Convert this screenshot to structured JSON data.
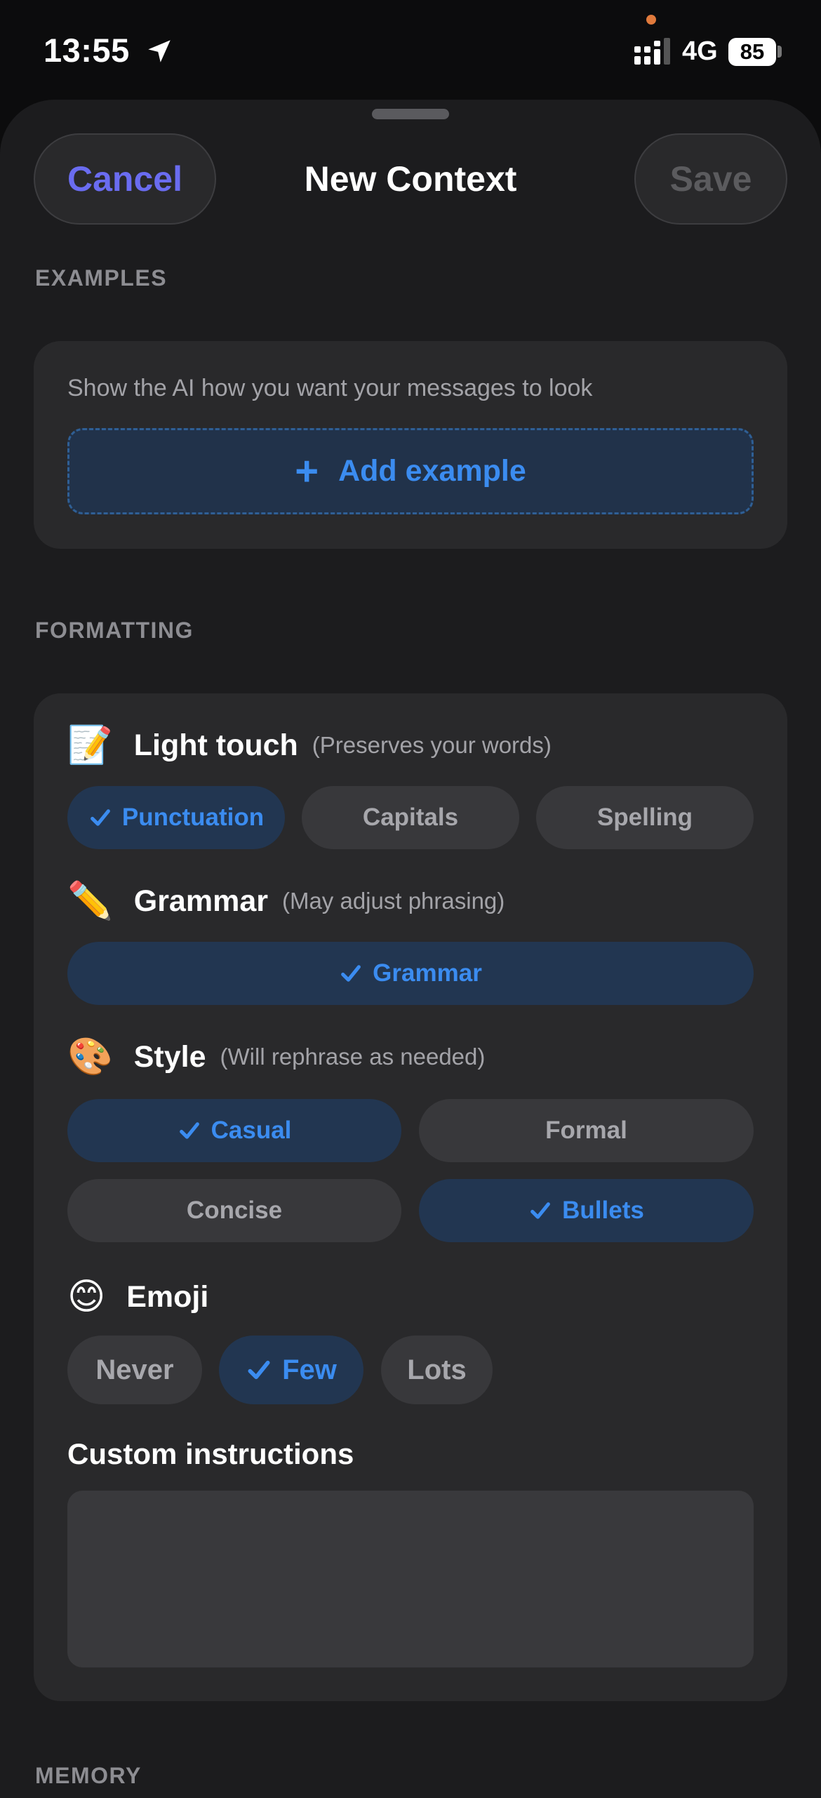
{
  "status_bar": {
    "time": "13:55",
    "network": "4G",
    "battery": "85"
  },
  "header": {
    "cancel_label": "Cancel",
    "title": "New Context",
    "save_label": "Save"
  },
  "examples": {
    "section_label": "EXAMPLES",
    "hint": "Show the AI how you want your messages to look",
    "add_label": "Add example"
  },
  "formatting": {
    "section_label": "FORMATTING",
    "light_touch": {
      "emoji": "📝",
      "title": "Light touch",
      "subtitle": "(Preserves your words)",
      "options": [
        {
          "label": "Punctuation",
          "selected": true
        },
        {
          "label": "Capitals",
          "selected": false
        },
        {
          "label": "Spelling",
          "selected": false
        }
      ]
    },
    "grammar": {
      "emoji": "✏️",
      "title": "Grammar",
      "subtitle": "(May adjust phrasing)",
      "options": [
        {
          "label": "Grammar",
          "selected": true
        }
      ]
    },
    "style": {
      "emoji": "🎨",
      "title": "Style",
      "subtitle": "(Will rephrase as needed)",
      "options": [
        {
          "label": "Casual",
          "selected": true
        },
        {
          "label": "Formal",
          "selected": false
        },
        {
          "label": "Concise",
          "selected": false
        },
        {
          "label": "Bullets",
          "selected": true
        }
      ]
    },
    "emoji_group": {
      "emoji": "😊",
      "title": "Emoji",
      "options": [
        {
          "label": "Never",
          "selected": false
        },
        {
          "label": "Few",
          "selected": true
        },
        {
          "label": "Lots",
          "selected": false
        }
      ]
    },
    "custom": {
      "label": "Custom instructions",
      "value": "",
      "placeholder": ""
    }
  },
  "memory_section_label": "MEMORY",
  "colors": {
    "accent": "#3b8cf0",
    "cancel": "#6a6cf0",
    "selected_chip_bg": "#223651",
    "chip_bg": "#38383b",
    "card_bg": "#29292b"
  }
}
